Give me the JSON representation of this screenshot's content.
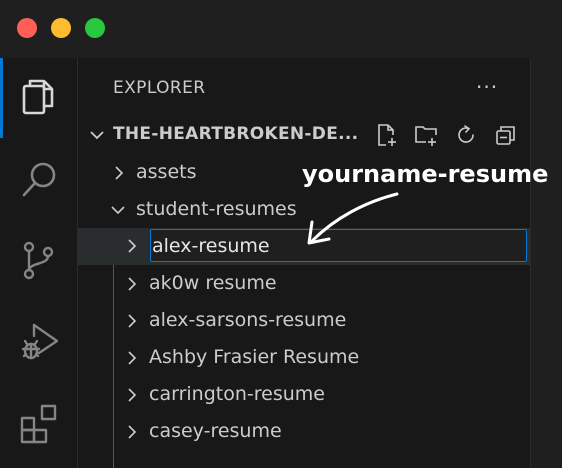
{
  "explorer": {
    "title": "EXPLORER",
    "more": "···",
    "section_title": "THE-HEARTBROKEN-DE..."
  },
  "tree": [
    {
      "label": "assets",
      "expanded": false
    },
    {
      "label": "student-resumes",
      "expanded": true
    },
    {
      "label": "",
      "expanded": false,
      "editing": true
    },
    {
      "label": "ak0w resume",
      "expanded": false
    },
    {
      "label": "alex-sarsons-resume",
      "expanded": false
    },
    {
      "label": "Ashby Frasier Resume",
      "expanded": false
    },
    {
      "label": "carrington-resume",
      "expanded": false
    },
    {
      "label": "casey-resume",
      "expanded": false
    }
  ],
  "rename": {
    "value": "alex-resume"
  },
  "annotation": {
    "text": "yourname-resume"
  },
  "colors": {
    "accent": "#0078d4",
    "close": "#ff5f57",
    "minimize": "#febc2e",
    "zoom": "#28c840"
  }
}
